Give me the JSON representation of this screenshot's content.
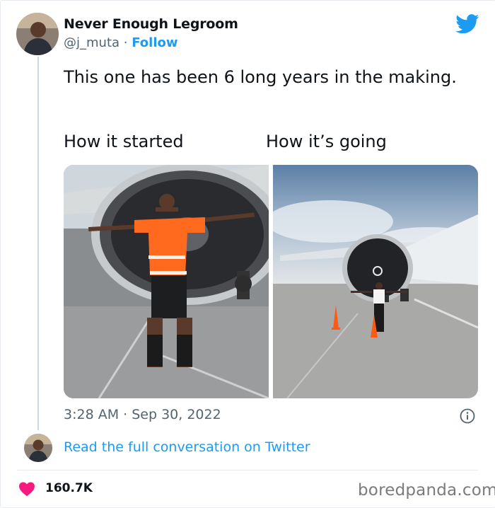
{
  "author": {
    "display_name": "Never Enough Legroom",
    "handle": "@j_muta",
    "separator": "·",
    "follow_label": "Follow"
  },
  "tweet": {
    "text": "This one has been 6 long years in the making.",
    "caption_left": "How it started",
    "caption_right": "How it’s going",
    "timestamp": "3:28 AM · Sep 30, 2022"
  },
  "conversation_link": "Read the full conversation on Twitter",
  "likes": "160.7K",
  "watermark": "boredpanda.com",
  "icons": [
    "twitter-bird-icon",
    "info-icon",
    "heart-icon"
  ],
  "colors": {
    "brand": "#1d9bf0",
    "like": "#f91880",
    "text": "#0f1419",
    "muted": "#536471"
  }
}
